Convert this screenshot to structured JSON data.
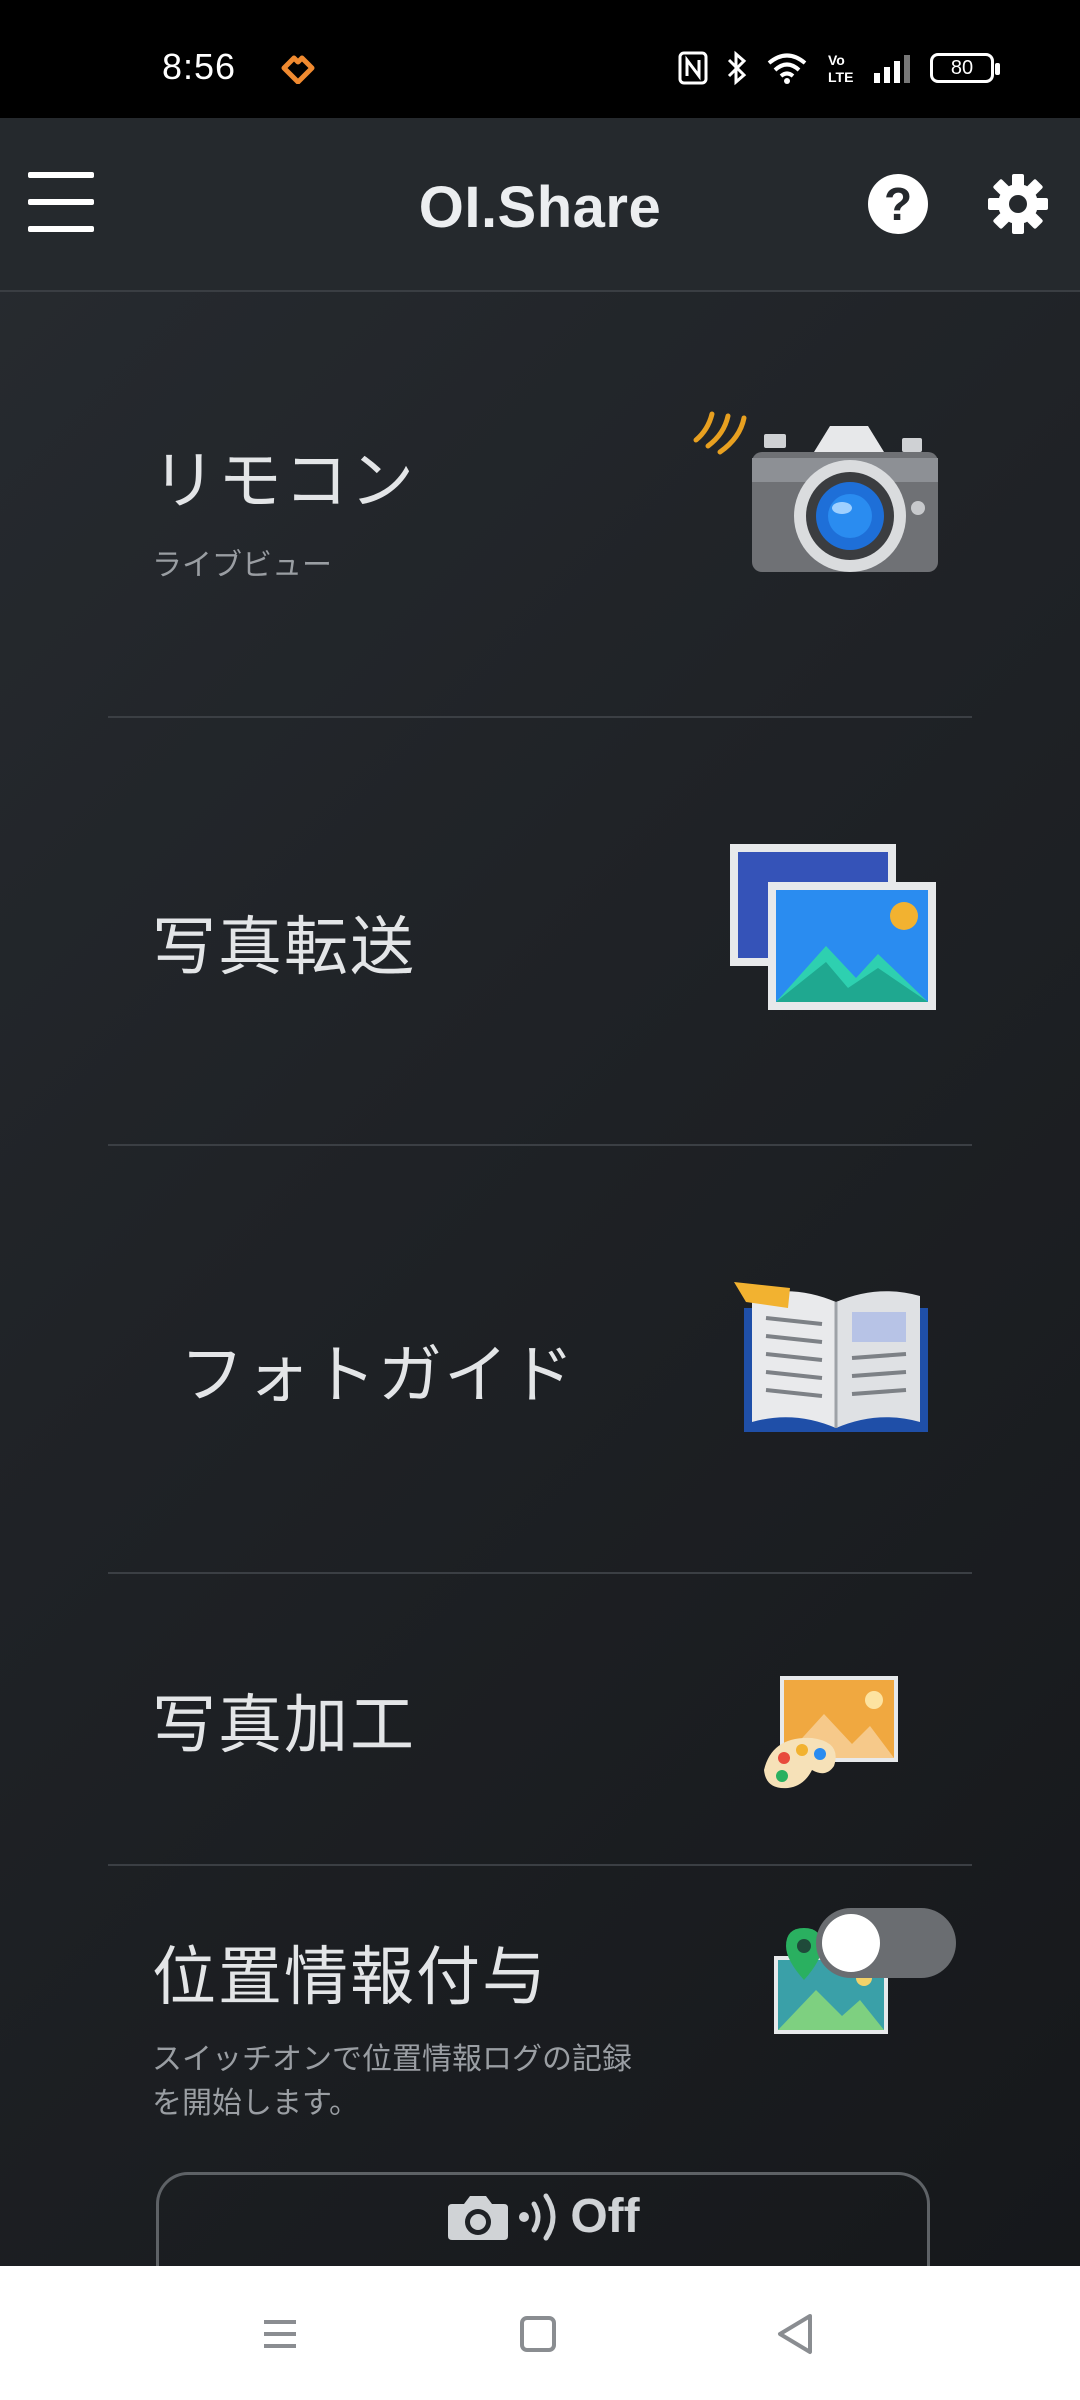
{
  "status_bar": {
    "time": "8:56",
    "battery": "80",
    "network_label": "Vo LTE"
  },
  "app_bar": {
    "title": "OI.Share"
  },
  "menu": {
    "remote": {
      "title": "リモコン",
      "subtitle": "ライブビュー"
    },
    "transfer": {
      "title": "写真転送"
    },
    "guide": {
      "title": "フォトガイド"
    },
    "edit": {
      "title": "写真加工"
    },
    "geotag": {
      "title": "位置情報付与",
      "subtitle_line1": "スイッチオンで位置情報ログの記録",
      "subtitle_line2": "を開始します。",
      "toggle_on": false
    }
  },
  "connection": {
    "status": "Off"
  },
  "colors": {
    "accent_blue": "#1e6fd8",
    "photo_blue": "#2a8cf0",
    "book_blue": "#1f4fa8",
    "orange": "#e89a3c",
    "toggle_off": "#6a6d71"
  }
}
